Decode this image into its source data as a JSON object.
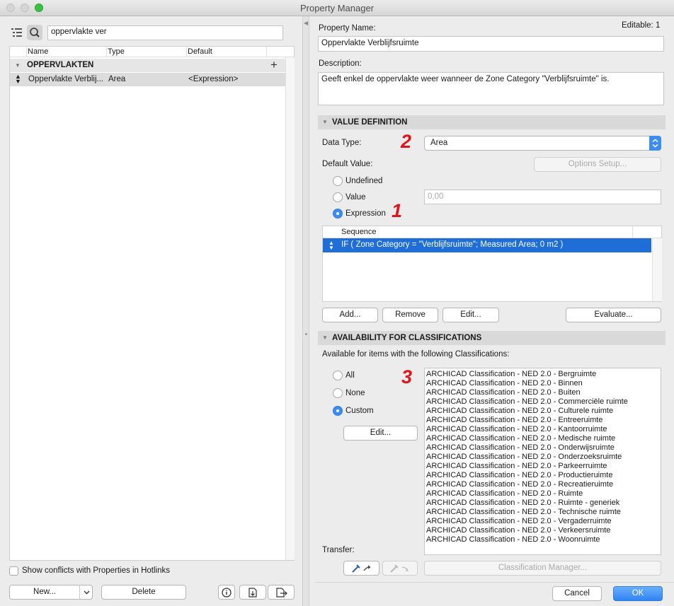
{
  "window": {
    "title": "Property Manager"
  },
  "left": {
    "search_value": "oppervlakte ver",
    "columns": [
      "Name",
      "Type",
      "Default"
    ],
    "group": "OPPERVLAKTEN",
    "row": {
      "name": "Oppervlakte Verblij...",
      "type": "Area",
      "default": "<Expression>"
    },
    "show_conflicts": "Show conflicts with Properties in Hotlinks",
    "new_button": "New...",
    "delete_button": "Delete"
  },
  "right": {
    "editable": "Editable: 1",
    "property_name_label": "Property Name:",
    "property_name_value": "Oppervlakte Verblijfsruimte",
    "description_label": "Description:",
    "description_value": "Geeft enkel de oppervlakte weer wanneer de Zone Category \"Verblijfsruimte\" is.",
    "value_def_header": "VALUE DEFINITION",
    "data_type_label": "Data Type:",
    "data_type_value": "Area",
    "default_value_label": "Default Value:",
    "options_setup": "Options Setup...",
    "radio_undefined": "Undefined",
    "radio_value": "Value",
    "radio_expression": "Expression",
    "value_placeholder": "0,00",
    "sequence_header": "Sequence",
    "sequence_row": "IF ( Zone Category = \"Verblijfsruimte\"; Measured Area; 0 m2 )",
    "add_button": "Add...",
    "remove_button": "Remove",
    "edit_button": "Edit...",
    "evaluate_button": "Evaluate...",
    "availability_header": "AVAILABILITY FOR CLASSIFICATIONS",
    "available_text": "Available for items with the following Classifications:",
    "radio_all": "All",
    "radio_none": "None",
    "radio_custom": "Custom",
    "class_edit_button": "Edit...",
    "classifications": [
      "ARCHICAD Classification - NED 2.0 - Bergruimte",
      "ARCHICAD Classification - NED 2.0 - Binnen",
      "ARCHICAD Classification - NED 2.0 - Buiten",
      "ARCHICAD Classification - NED 2.0 - Commerciële ruimte",
      "ARCHICAD Classification - NED 2.0 - Culturele ruimte",
      "ARCHICAD Classification - NED 2.0 - Entreeruimte",
      "ARCHICAD Classification - NED 2.0 - Kantoorruimte",
      "ARCHICAD Classification - NED 2.0 - Medische ruimte",
      "ARCHICAD Classification - NED 2.0 - Onderwijsruimte",
      "ARCHICAD Classification - NED 2.0 - Onderzoeksruimte",
      "ARCHICAD Classification - NED 2.0 - Parkeerruimte",
      "ARCHICAD Classification - NED 2.0 - Productieruimte",
      "ARCHICAD Classification - NED 2.0 - Recreatieruimte",
      "ARCHICAD Classification - NED 2.0 - Ruimte",
      "ARCHICAD Classification - NED 2.0 - Ruimte - generiek",
      "ARCHICAD Classification - NED 2.0 - Technische ruimte",
      "ARCHICAD Classification - NED 2.0 - Vergaderruimte",
      "ARCHICAD Classification - NED 2.0 - Verkeersruimte",
      "ARCHICAD Classification - NED 2.0 - Woonruimte"
    ],
    "transfer_label": "Transfer:",
    "classification_manager": "Classification Manager...",
    "cancel_button": "Cancel",
    "ok_button": "OK"
  },
  "annotations": {
    "one": "1",
    "two": "2",
    "three": "3"
  },
  "colors": {
    "accent": "#3b8df5",
    "annotation": "#e3141b",
    "selection": "#1f6ed8"
  },
  "icons": [
    "list-view-icon",
    "search-icon",
    "plus-icon",
    "sort-arrows-icon",
    "info-icon",
    "import-icon",
    "export-icon",
    "eyedropper-icon",
    "inject-icon",
    "chevron-down-icon"
  ]
}
